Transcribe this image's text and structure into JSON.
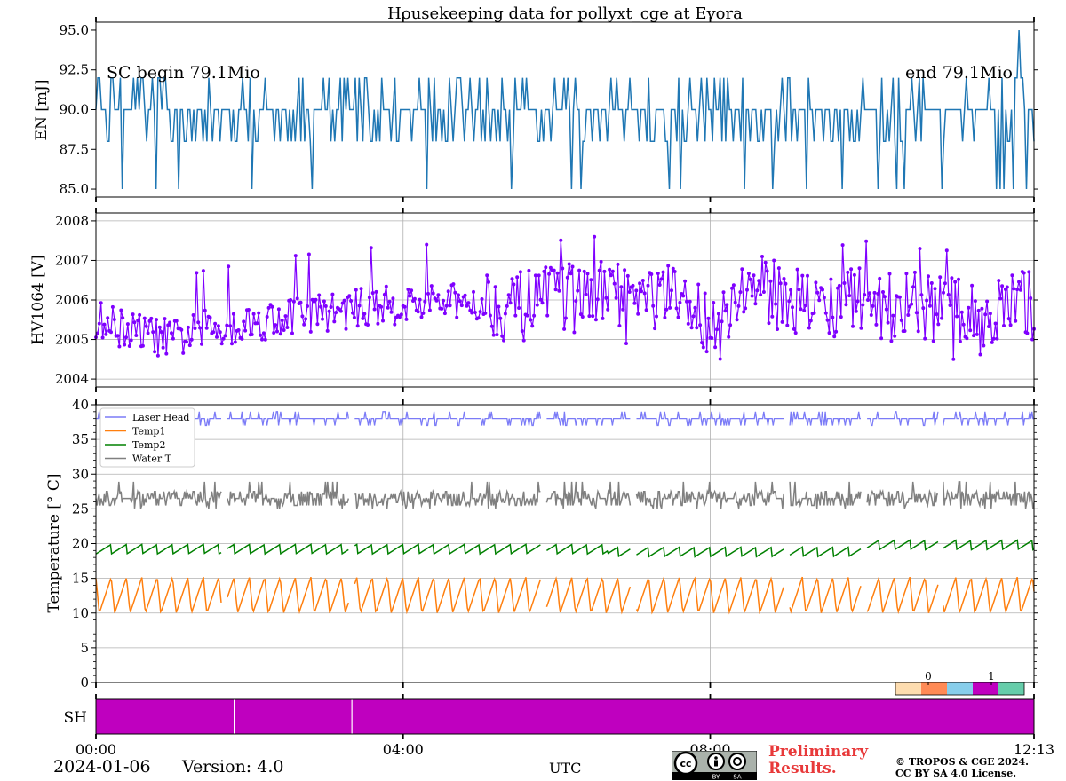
{
  "title": "Housekeeping data for pollyxt_cge at Evora",
  "footer": {
    "date": "2024-01-06",
    "version": "Version: 4.0",
    "xaxis_label": "UTC",
    "preliminary": [
      "Preliminary",
      "Results."
    ],
    "copyright": [
      "© TROPOS & CGE 2024.",
      "CC BY SA 4.0 License."
    ],
    "cc_badge": {
      "left": "BY",
      "right": "SA"
    }
  },
  "colors": {
    "energy": "#1f77b4",
    "hv": "#7f00ff",
    "laser_head": "#7b7bf7",
    "temp1": "#ff7f0e",
    "temp2": "#008000",
    "water": "#808080",
    "shutter": "#bf00bf",
    "preliminary": "#e8393a"
  },
  "chart_data": [
    {
      "panel": "energy",
      "type": "line",
      "ylabel": "EN [mJ]",
      "ylim": [
        84.5,
        95.5
      ],
      "yticks": [
        "85.0",
        "87.5",
        "90.0",
        "92.5",
        "95.0"
      ],
      "grid": false,
      "annotations": [
        "SC begin 79.1Mio",
        "end 79.1Mio"
      ],
      "x": [
        "00:00",
        "00:30",
        "01:00",
        "01:30",
        "02:00",
        "02:30",
        "03:00",
        "03:30",
        "04:00",
        "04:30",
        "05:00",
        "05:30",
        "06:00",
        "06:30",
        "07:00",
        "07:30",
        "08:00",
        "08:30",
        "09:00",
        "09:30",
        "10:00",
        "10:30",
        "11:00",
        "11:30",
        "12:00",
        "12:13"
      ],
      "values": [
        88,
        90,
        92,
        88,
        85,
        90,
        88,
        92,
        90,
        85,
        90,
        88,
        92,
        90,
        85,
        88,
        90,
        88,
        92,
        90,
        85,
        90,
        88,
        85,
        90,
        95
      ],
      "series": [
        {
          "name": "EN",
          "min": 85.0,
          "max": 95.0,
          "typical": 90.0
        }
      ]
    },
    {
      "panel": "hv1064",
      "type": "line",
      "ylabel": "HV1064 [V]",
      "ylim": [
        2003.8,
        2008.2
      ],
      "yticks": [
        "2004",
        "2005",
        "2006",
        "2007",
        "2008"
      ],
      "grid": true,
      "x": [
        "00:00",
        "00:30",
        "01:00",
        "01:30",
        "02:00",
        "02:30",
        "03:00",
        "03:30",
        "04:00",
        "04:30",
        "05:00",
        "05:30",
        "06:00",
        "06:30",
        "07:00",
        "07:30",
        "08:00",
        "08:30",
        "09:00",
        "09:30",
        "10:00",
        "10:30",
        "11:00",
        "11:30",
        "12:00",
        "12:13"
      ],
      "values": [
        2005.5,
        2005.2,
        2005.0,
        2005.3,
        2005.4,
        2005.6,
        2005.7,
        2005.8,
        2005.9,
        2005.9,
        2006.0,
        2005.8,
        2006.0,
        2006.1,
        2006.1,
        2006.0,
        2005.5,
        2006.3,
        2006.1,
        2005.8,
        2006.0,
        2005.8,
        2005.8,
        2005.5,
        2005.9,
        2005.8
      ],
      "extremes": {
        "min": 2004.3,
        "max": 2007.6
      }
    },
    {
      "panel": "temperature",
      "type": "line",
      "ylabel": "Temperature [$^\\circ C$]",
      "ylim": [
        0,
        40
      ],
      "yticks": [
        "0",
        "5",
        "10",
        "15",
        "20",
        "25",
        "30",
        "35",
        "40"
      ],
      "grid": true,
      "legend": "top-left",
      "series": [
        {
          "name": "Laser Head",
          "typical": 38,
          "range": [
            37,
            39
          ]
        },
        {
          "name": "Temp1",
          "range": [
            9.5,
            16
          ],
          "period_hours": 0.2
        },
        {
          "name": "Temp2",
          "range": [
            18,
            20
          ],
          "period_hours": 0.2
        },
        {
          "name": "Water T",
          "range": [
            24,
            29
          ],
          "typical": 26.5
        }
      ]
    },
    {
      "panel": "shutter",
      "type": "heatmap",
      "ylabel": "SH",
      "value": 1,
      "colorbar": {
        "ticks": [
          "0",
          "1"
        ],
        "colors": [
          "#fddcaf",
          "#ff8a55",
          "#87ceeb",
          "#bf00bf",
          "#66cdaa"
        ]
      },
      "gaps": [
        "01:48",
        "03:20"
      ]
    }
  ],
  "xaxis": {
    "ticks": [
      "00:00",
      "04:00",
      "08:00",
      "12:13"
    ],
    "range": [
      "00:00",
      "12:13"
    ]
  }
}
